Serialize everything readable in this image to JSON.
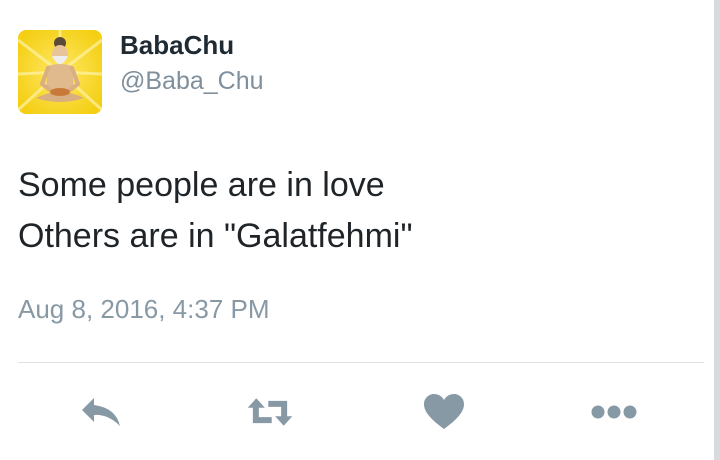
{
  "user": {
    "display_name": "BabaChu",
    "handle": "@Baba_Chu",
    "avatar_icon": "meditating-sage-avatar",
    "avatar_bg_color": "#f7d51c"
  },
  "tweet": {
    "lines": [
      "Some people are in love",
      "Others are in \"Galatfehmi\""
    ],
    "timestamp": "Aug 8, 2016, 4:37 PM"
  },
  "actions": [
    {
      "icon": "reply-icon"
    },
    {
      "icon": "retweet-icon"
    },
    {
      "icon": "heart-icon"
    },
    {
      "icon": "more-icon"
    }
  ],
  "colors": {
    "text_primary": "#1f2428",
    "text_secondary": "#8899a6",
    "icon_gray": "#8899a6",
    "divider": "#dfe3e6"
  }
}
